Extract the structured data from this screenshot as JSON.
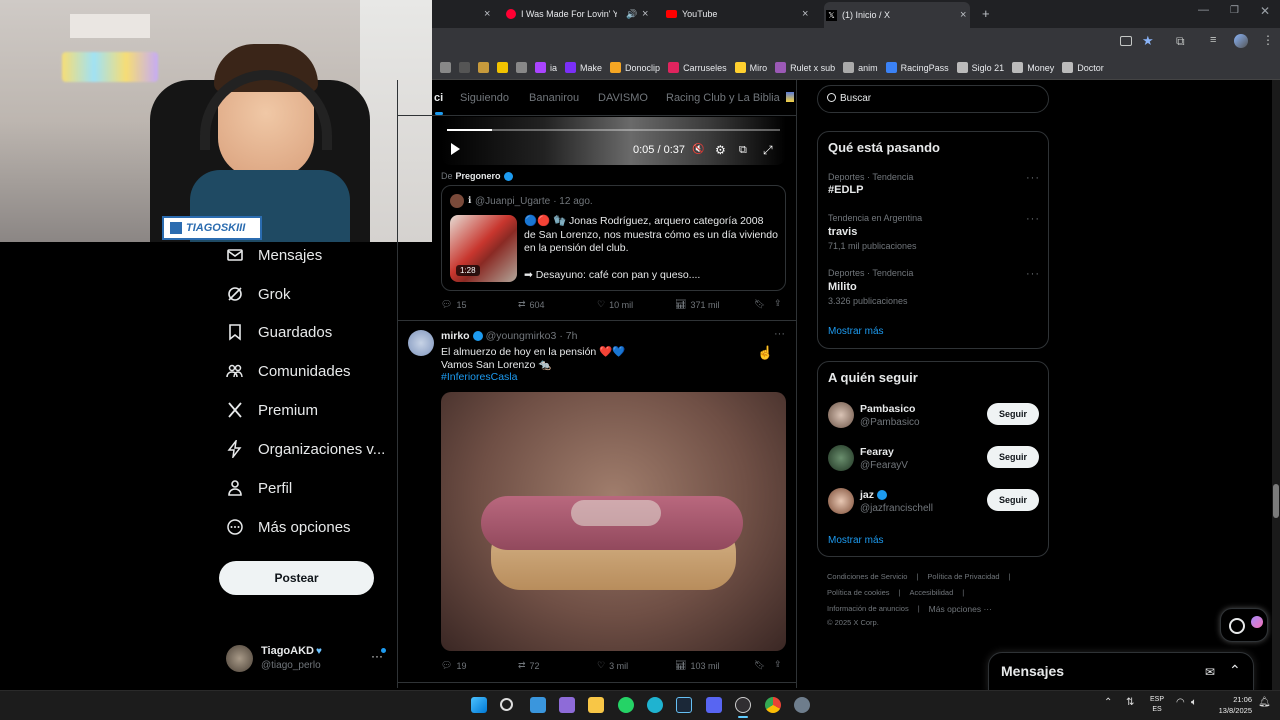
{
  "browser": {
    "tabs": [
      {
        "title": "I Was Made For Lovin' You",
        "icon": "youtube-music-icon",
        "muted": true
      },
      {
        "title": "YouTube",
        "icon": "youtube-icon"
      },
      {
        "title": "(1) Inicio / X",
        "icon": "x-icon"
      }
    ],
    "bookmarks": [
      {
        "label": "",
        "color": "#888"
      },
      {
        "label": "",
        "color": "#555"
      },
      {
        "label": "",
        "color": "#c79a3c"
      },
      {
        "label": "",
        "color": "#f2c300"
      },
      {
        "label": "",
        "color": "#888"
      },
      {
        "label": "ia",
        "color": "#aa44ff"
      },
      {
        "label": "Make",
        "color": "#7b2ff7"
      },
      {
        "label": "Donoclip",
        "color": "#f5a623"
      },
      {
        "label": "Carruseles",
        "color": "#e0245e"
      },
      {
        "label": "Miro",
        "color": "#ffd02f"
      },
      {
        "label": "Rulet x sub",
        "color": "#9b59b6"
      },
      {
        "label": "anim",
        "color": "#aaaaaa"
      },
      {
        "label": "RacingPass",
        "color": "#3b82f6"
      },
      {
        "label": "Siglo 21",
        "color": "#bbbbbb"
      },
      {
        "label": "Money",
        "color": "#bbbbbb"
      },
      {
        "label": "Doctor",
        "color": "#bbbbbb"
      }
    ]
  },
  "webcam": {
    "banner": "TIAGOSKIII"
  },
  "nav": {
    "items": [
      {
        "label": "Mensajes",
        "icon": "mail-icon"
      },
      {
        "label": "Grok",
        "icon": "grok-icon"
      },
      {
        "label": "Guardados",
        "icon": "bookmark-icon"
      },
      {
        "label": "Comunidades",
        "icon": "people-icon"
      },
      {
        "label": "Premium",
        "icon": "x-logo-icon"
      },
      {
        "label": "Organizaciones v...",
        "icon": "lightning-icon"
      },
      {
        "label": "Perfil",
        "icon": "person-icon"
      },
      {
        "label": "Más opciones",
        "icon": "more-circle-icon"
      }
    ],
    "post_button": "Postear",
    "account": {
      "name": "TiagoAKD",
      "handle": "@tiago_perlo"
    }
  },
  "feed": {
    "tabs": [
      "ci",
      "Siguiendo",
      "Bananirou",
      "DAVISMO",
      "Racing Club y La Biblia"
    ],
    "video": {
      "time": "0:05 / 0:37",
      "progress": 0.135
    },
    "quote_source_prefix": "De",
    "quote_source": "Pregonero",
    "quote": {
      "handle": "@Juanpi_Ugarte",
      "time": "· 12 ago.",
      "text": "🔵🔴 🧤 Jonas Rodríguez, arquero categoría 2008 de San Lorenzo, nos muestra cómo es un día viviendo en la pensión del club.",
      "text2": "➡ Desayuno: café con pan y queso....",
      "duration": "1:28"
    },
    "post1_stats": {
      "replies": "15",
      "reposts": "604",
      "likes": "10 mil",
      "views": "371 mil"
    },
    "post2": {
      "name": "mirko",
      "handle": "@youngmirko3",
      "time": "· 7h",
      "line1": "El almuerzo de hoy en la pensión ❤️💙",
      "line2": "Vamos San Lorenzo 🐀",
      "hashtag": "#InferioresCasla",
      "stats": {
        "replies": "19",
        "reposts": "72",
        "likes": "3 mil",
        "views": "103 mil"
      }
    }
  },
  "right": {
    "search_placeholder": "Buscar",
    "trends_title": "Qué está pasando",
    "trends": [
      {
        "context": "Deportes · Tendencia",
        "name": "#EDLP",
        "count": ""
      },
      {
        "context": "Tendencia en Argentina",
        "name": "travis",
        "count": "71,1 mil publicaciones"
      },
      {
        "context": "Deportes · Tendencia",
        "name": "Milito",
        "count": "3.326 publicaciones"
      }
    ],
    "show_more": "Mostrar más",
    "follow_title": "A quién seguir",
    "follow": [
      {
        "name": "Pambasico",
        "handle": "@Pambasico",
        "button": "Seguir"
      },
      {
        "name": "Fearay",
        "handle": "@FearayV",
        "button": "Seguir"
      },
      {
        "name": "jaz",
        "handle": "@jazfrancischell",
        "button": "Seguir"
      }
    ],
    "footer": {
      "l1a": "Condiciones de Servicio",
      "l1b": "Política de Privacidad",
      "l2a": "Política de cookies",
      "l2b": "Accesibilidad",
      "l3a": "Información de anuncios",
      "l3b": "Más opciones ···",
      "copy": "© 2025 X Corp."
    },
    "messages_title": "Mensajes"
  },
  "taskbar": {
    "lang1": "ESP",
    "lang2": "ES",
    "time": "21:06",
    "date": "13/8/2025"
  },
  "colors": {
    "accent": "#1d9bf0",
    "background": "#000000",
    "border": "#2f3336",
    "muted": "#71767b"
  }
}
